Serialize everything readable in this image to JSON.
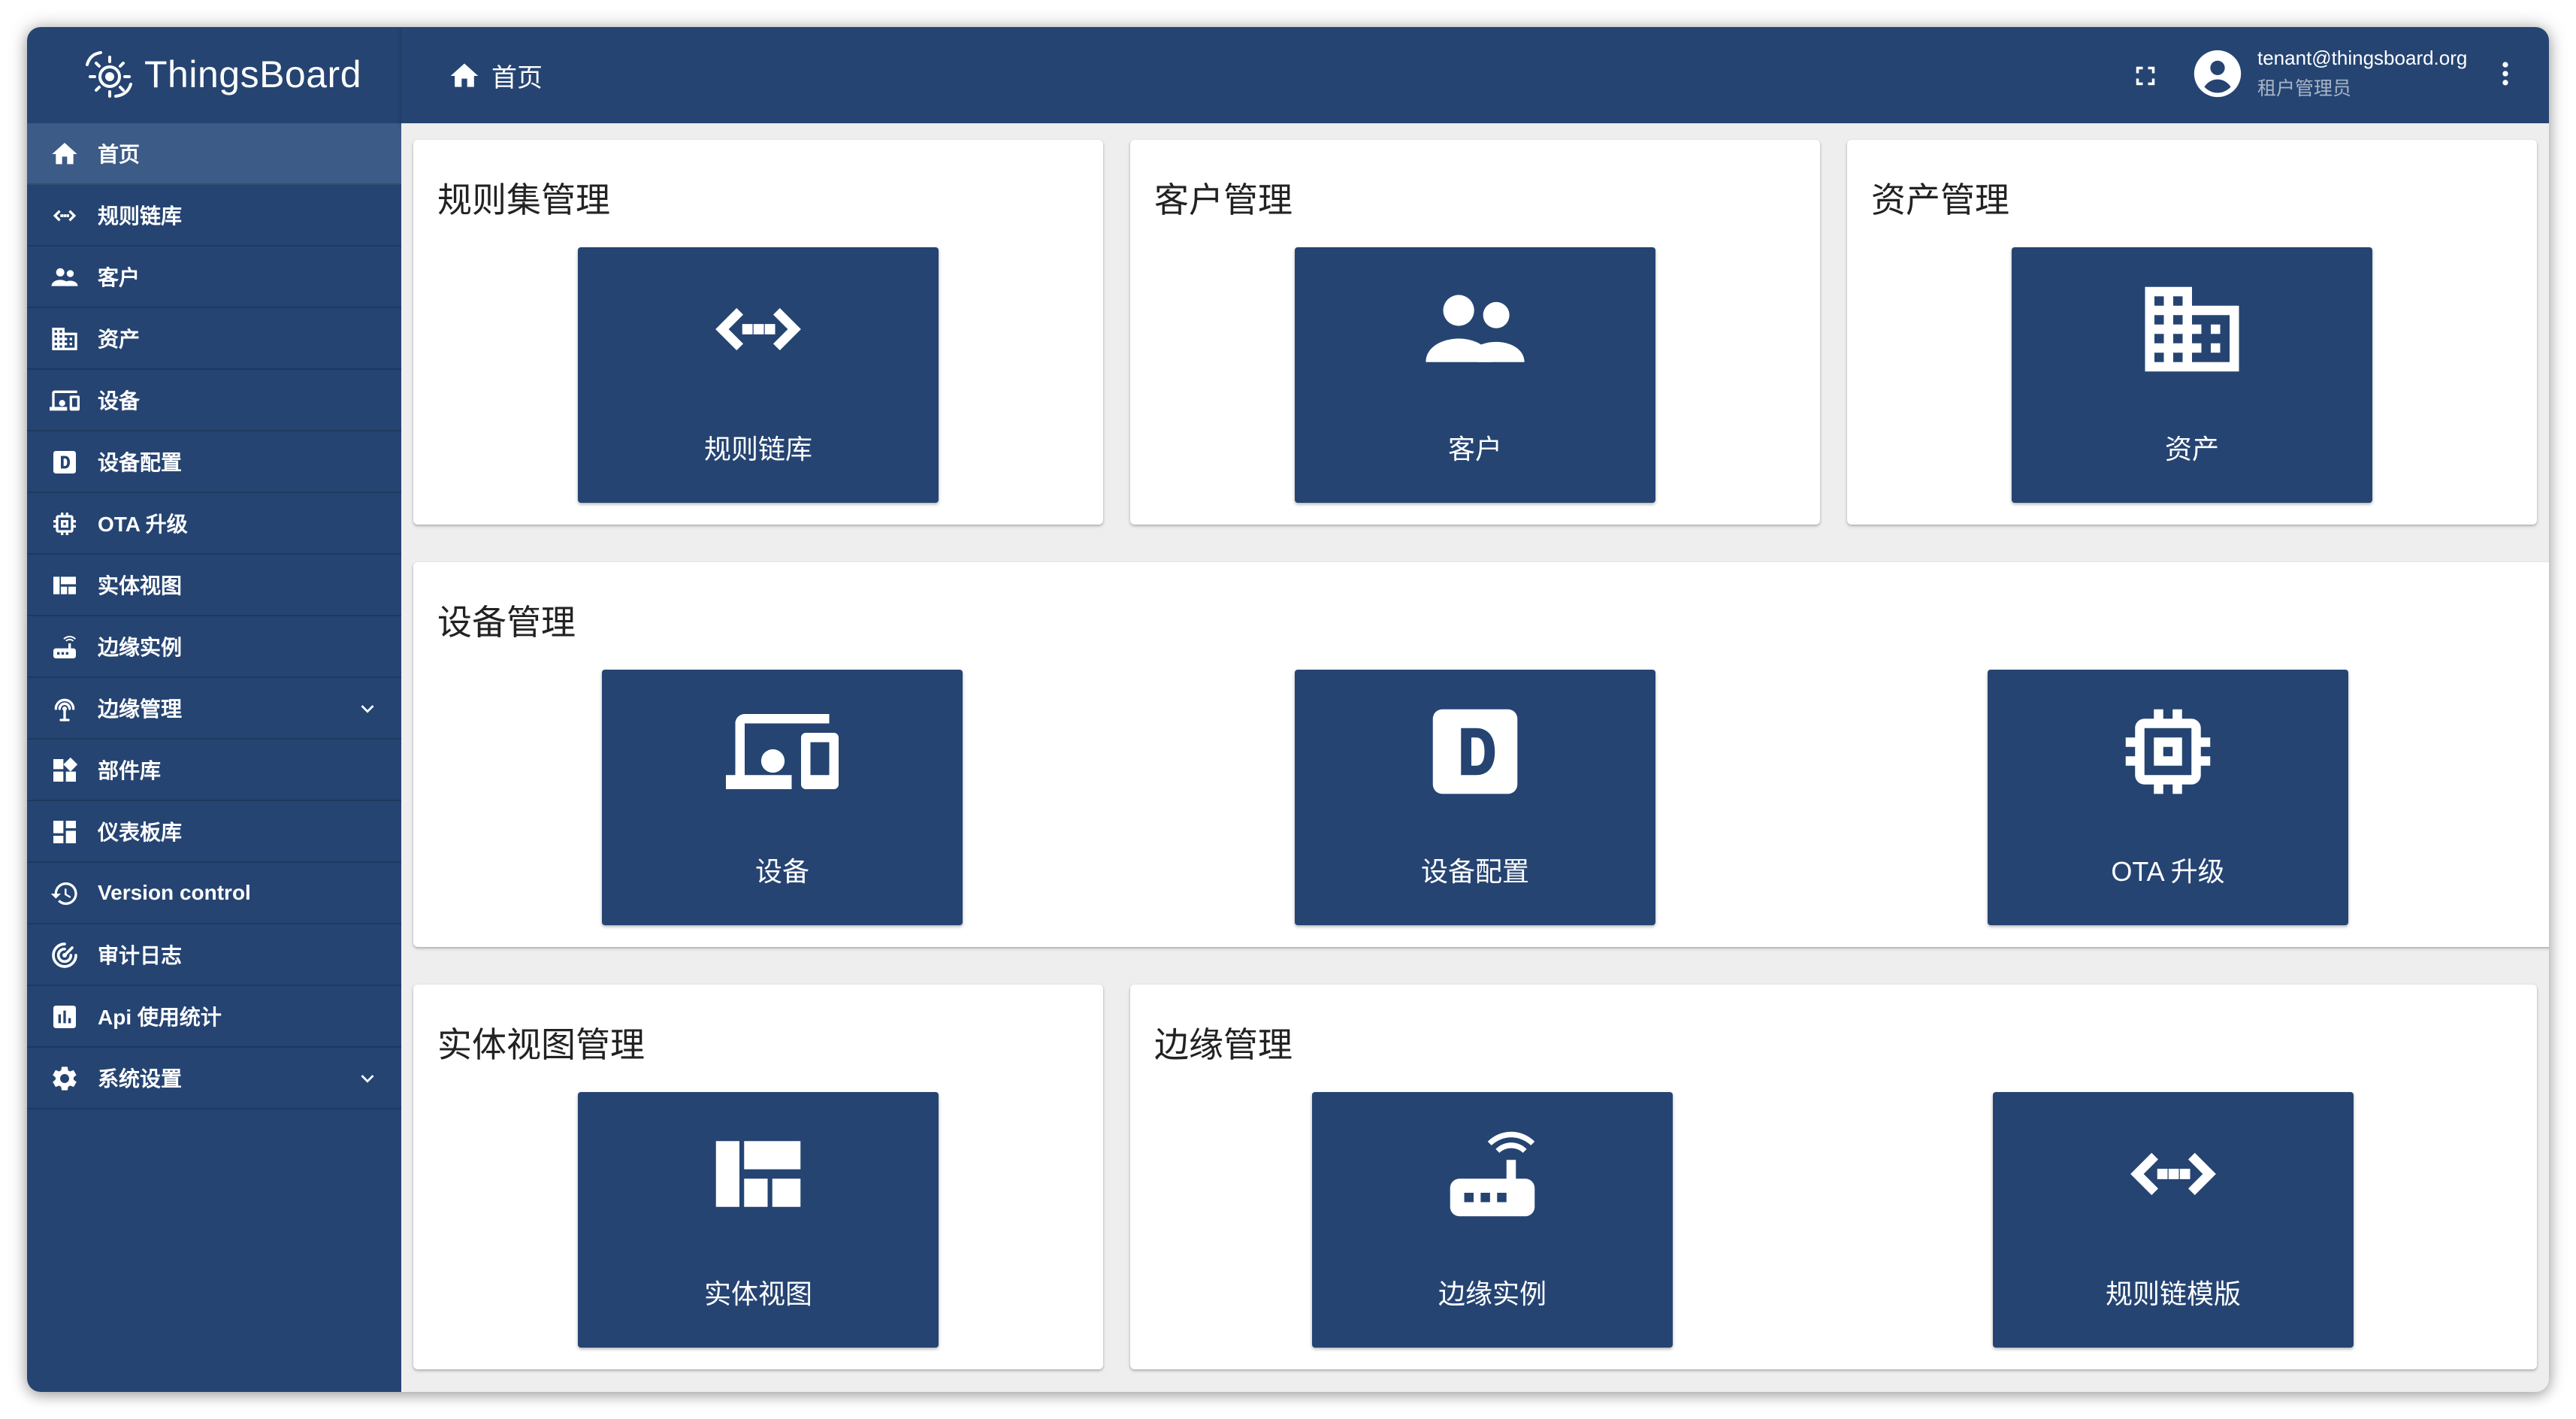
{
  "app": {
    "name": "ThingsBoard"
  },
  "sidebar": {
    "items": [
      {
        "label": "首页",
        "icon": "home-icon",
        "active": true
      },
      {
        "label": "规则链库",
        "icon": "rule-chain-icon"
      },
      {
        "label": "客户",
        "icon": "customers-icon"
      },
      {
        "label": "资产",
        "icon": "assets-icon"
      },
      {
        "label": "设备",
        "icon": "devices-icon"
      },
      {
        "label": "设备配置",
        "icon": "device-profile-icon"
      },
      {
        "label": "OTA 升级",
        "icon": "ota-chip-icon"
      },
      {
        "label": "实体视图",
        "icon": "entity-view-icon"
      },
      {
        "label": "边缘实例",
        "icon": "edge-router-icon"
      },
      {
        "label": "边缘管理",
        "icon": "edge-antenna-icon",
        "expandable": true
      },
      {
        "label": "部件库",
        "icon": "widgets-icon"
      },
      {
        "label": "仪表板库",
        "icon": "dashboards-icon"
      },
      {
        "label": "Version control",
        "icon": "history-icon"
      },
      {
        "label": "审计日志",
        "icon": "audit-icon"
      },
      {
        "label": "Api 使用统计",
        "icon": "api-stats-icon"
      },
      {
        "label": "系统设置",
        "icon": "settings-gear-icon",
        "expandable": true
      }
    ]
  },
  "header": {
    "breadcrumb": "首页",
    "user": {
      "email": "tenant@thingsboard.org",
      "role": "租户管理员"
    }
  },
  "cards": {
    "rulechain": {
      "title": "规则集管理",
      "tiles": [
        {
          "label": "规则链库",
          "icon": "rule-chain-icon"
        }
      ]
    },
    "customer": {
      "title": "客户管理",
      "tiles": [
        {
          "label": "客户",
          "icon": "customers-icon"
        }
      ]
    },
    "asset": {
      "title": "资产管理",
      "tiles": [
        {
          "label": "资产",
          "icon": "assets-icon"
        }
      ]
    },
    "device": {
      "title": "设备管理",
      "tiles": [
        {
          "label": "设备",
          "icon": "devices-icon"
        },
        {
          "label": "设备配置",
          "icon": "device-profile-icon"
        },
        {
          "label": "OTA 升级",
          "icon": "ota-chip-icon"
        }
      ]
    },
    "entityview": {
      "title": "实体视图管理",
      "tiles": [
        {
          "label": "实体视图",
          "icon": "entity-view-icon"
        }
      ]
    },
    "edge": {
      "title": "边缘管理",
      "tiles": [
        {
          "label": "边缘实例",
          "icon": "edge-router-icon"
        },
        {
          "label": "规则链模版",
          "icon": "rule-chain-icon"
        }
      ]
    }
  },
  "colors": {
    "primary": "#254472",
    "sidebar_active": "#3c5b87",
    "background": "#eeeeee",
    "card": "#ffffff"
  }
}
